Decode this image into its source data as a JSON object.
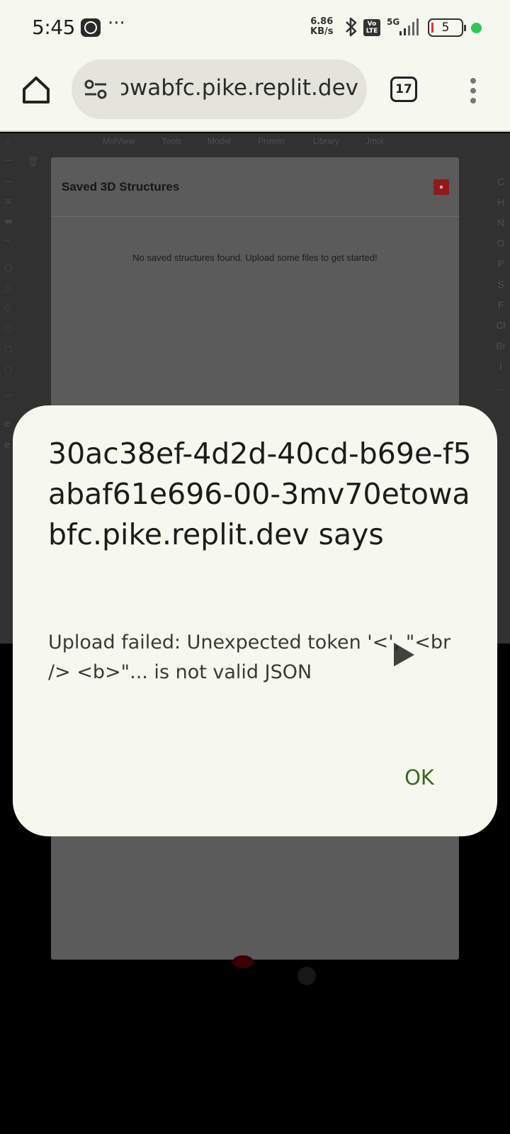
{
  "status_bar": {
    "time": "5:45",
    "more": "···",
    "net_speed_value": "6.86",
    "net_speed_unit": "KB/s",
    "volte_label": "Vo LTE",
    "signal_label": "5G",
    "battery_level": "5",
    "accent_dot_color": "#32c65a"
  },
  "browser": {
    "url": "30ac38ef-4d2d-40cd-b69e-f5abaf61e696-00-3mv70etowabfc.pike.replit.dev",
    "tab_count": "17"
  },
  "page": {
    "menu": [
      "MolView",
      "Tools",
      "Model",
      "Protein",
      "Library",
      "Jmol"
    ],
    "elements": [
      "C",
      "H",
      "N",
      "O",
      "P",
      "S",
      "F",
      "Cl",
      "Br",
      "I",
      "..."
    ],
    "left_letters": [
      "e",
      "e"
    ]
  },
  "modal": {
    "title": "Saved 3D Structures",
    "empty_message": "No saved structures found. Upload some files to get started!"
  },
  "dialog": {
    "title": "30ac38ef-4d2d-40cd-b69e-f5abaf61e696-00-3mv70etowabfc.pike.replit.dev says",
    "message": "Upload failed: Unexpected token '<', \"<br />\n<b>\"... is not valid JSON",
    "ok_label": "OK",
    "ok_color": "#3e6a1e"
  }
}
